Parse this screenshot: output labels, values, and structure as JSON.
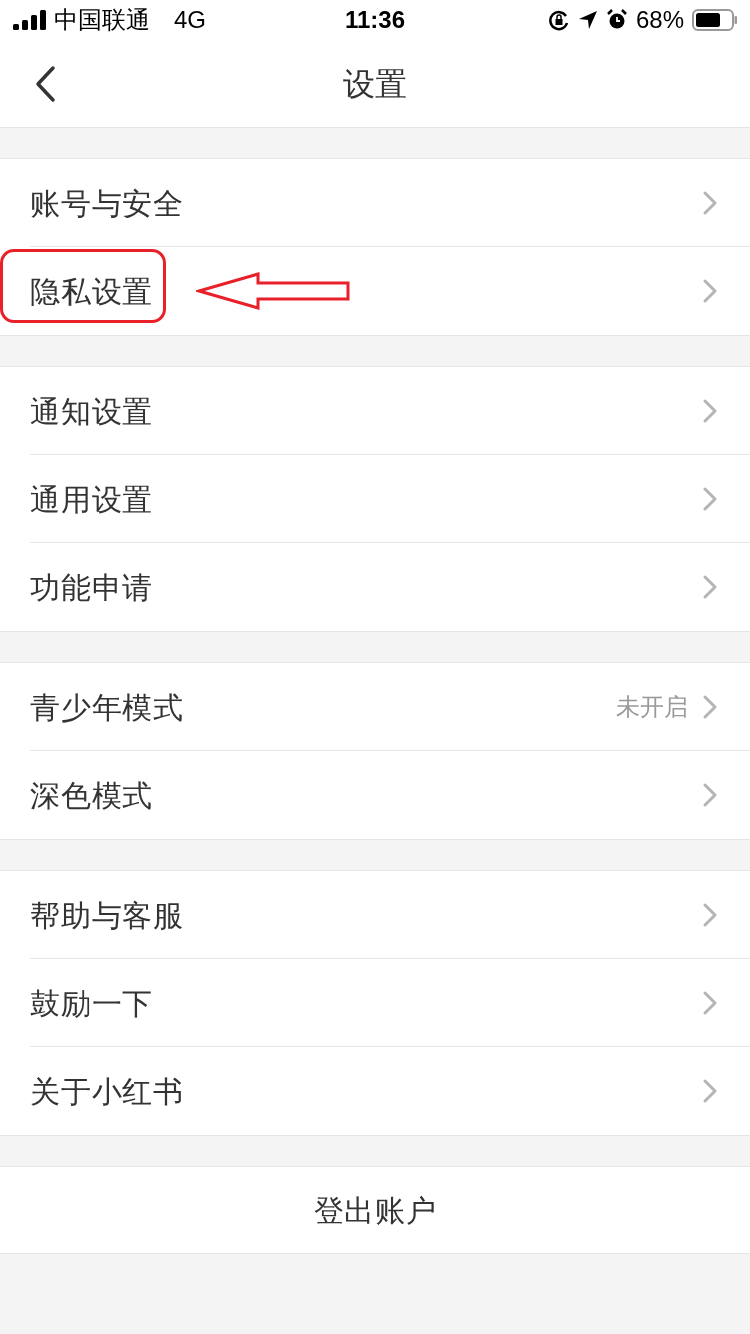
{
  "status_bar": {
    "carrier": "中国联通",
    "network": "4G",
    "time": "11:36",
    "battery": "68%"
  },
  "nav": {
    "title": "设置"
  },
  "groups": [
    {
      "items": [
        {
          "label": "账号与安全",
          "highlighted": false
        },
        {
          "label": "隐私设置",
          "highlighted": true
        }
      ]
    },
    {
      "items": [
        {
          "label": "通知设置",
          "highlighted": false
        },
        {
          "label": "通用设置",
          "highlighted": false
        },
        {
          "label": "功能申请",
          "highlighted": false
        }
      ]
    },
    {
      "items": [
        {
          "label": "青少年模式",
          "value": "未开启",
          "highlighted": false
        },
        {
          "label": "深色模式",
          "highlighted": false
        }
      ]
    },
    {
      "items": [
        {
          "label": "帮助与客服",
          "highlighted": false
        },
        {
          "label": "鼓励一下",
          "highlighted": false
        },
        {
          "label": "关于小红书",
          "highlighted": false
        }
      ]
    }
  ],
  "logout": {
    "label": "登出账户"
  }
}
